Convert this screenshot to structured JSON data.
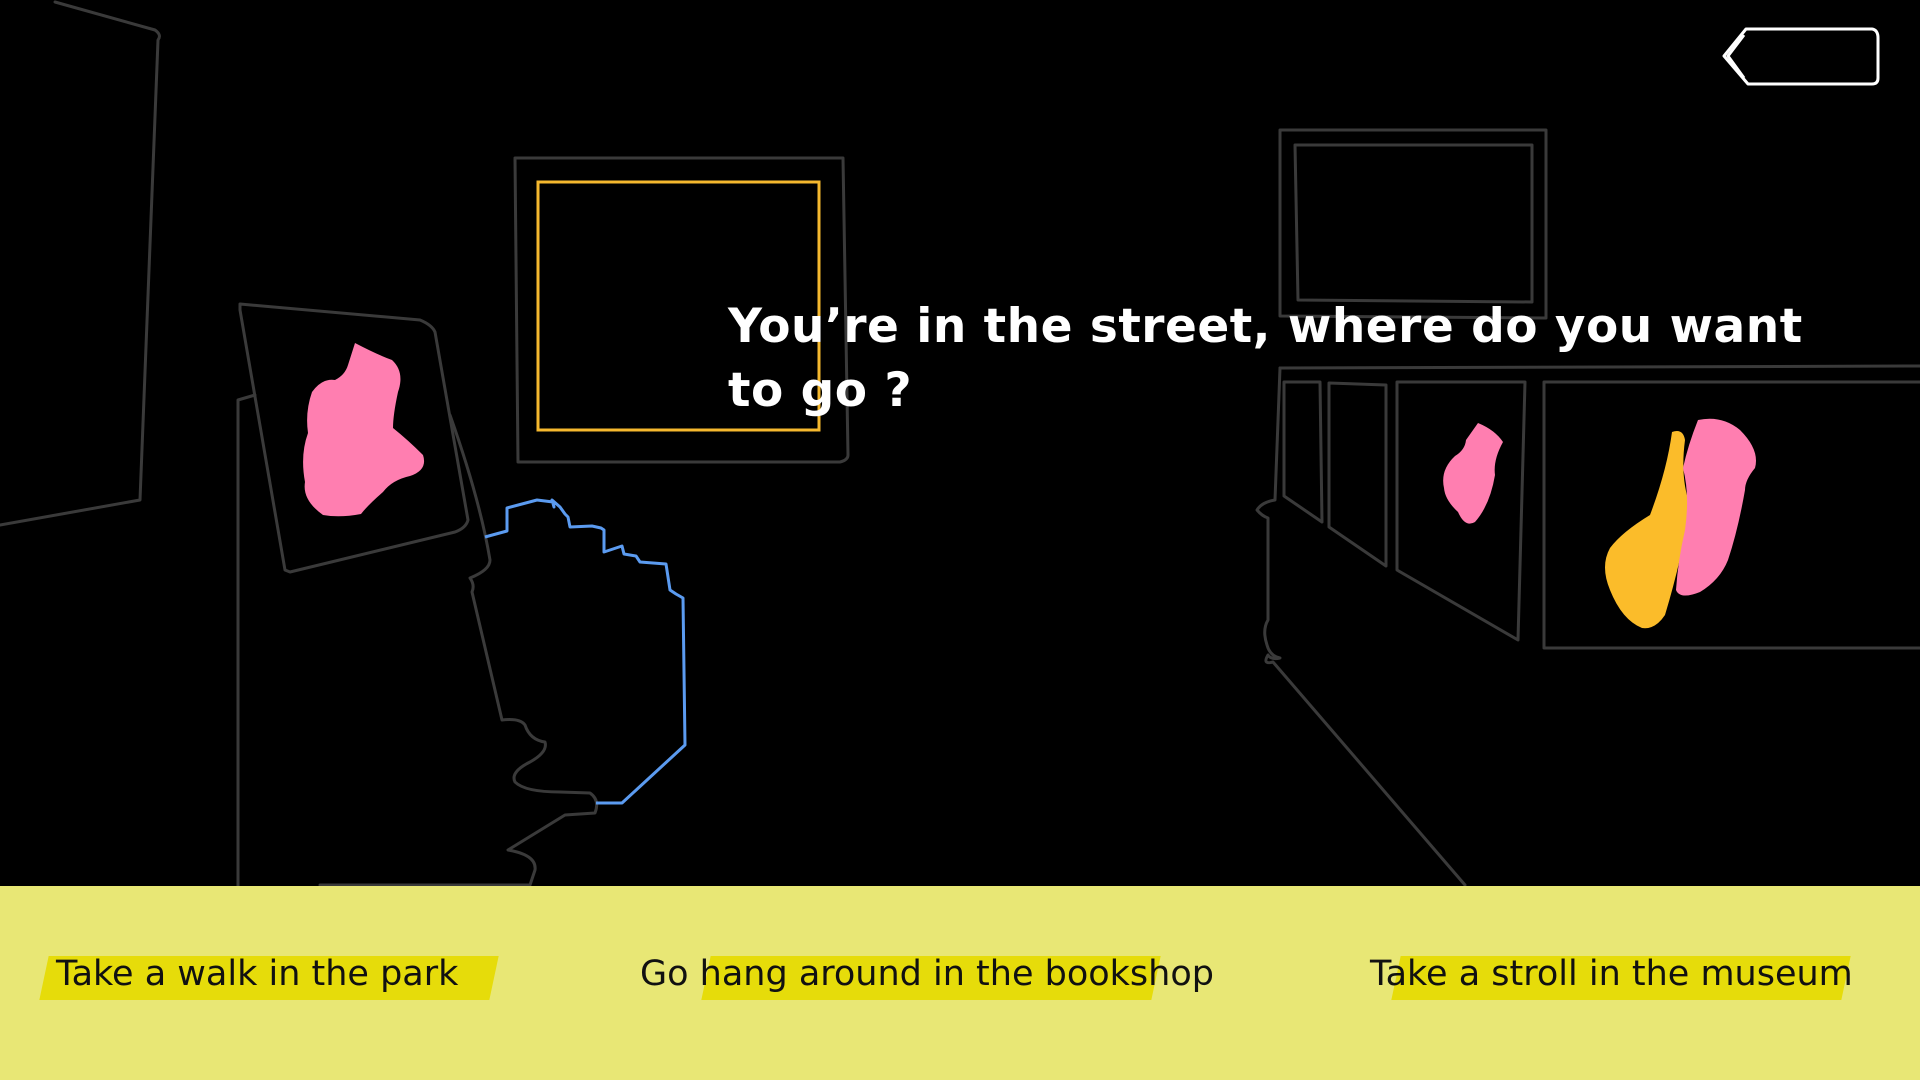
{
  "scene": {
    "prompt": "You’re in the street, where do you want to go ?",
    "colors": {
      "background": "#000000",
      "outline": "#3a3a3a",
      "pink": "#ff7eb0",
      "yellow": "#fbbc2a",
      "blue": "#5b9bf0",
      "frame_highlight": "#f5b82e"
    }
  },
  "back_button": {
    "icon": "chevron-left-icon"
  },
  "choices": [
    {
      "label": "Take a walk in the park"
    },
    {
      "label": "Go hang around in the bookshop"
    },
    {
      "label": "Take a stroll in the museum"
    }
  ],
  "choice_panel": {
    "background": "#e8e775",
    "highlight": "#e6dc0a"
  }
}
